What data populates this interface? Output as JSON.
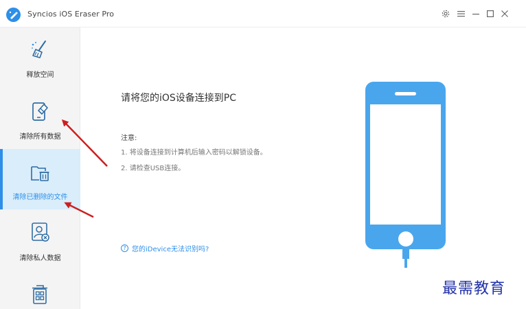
{
  "app": {
    "title": "Syncios iOS Eraser Pro",
    "icons": [
      "app-logo-icon",
      "settings-icon",
      "menu-icon",
      "minimize-icon",
      "maximize-icon",
      "close-icon"
    ]
  },
  "sidebar": {
    "items": [
      {
        "label": "释放空间",
        "icon": "broom-icon",
        "active": false
      },
      {
        "label": "清除所有数据",
        "icon": "phone-eraser-icon",
        "active": false
      },
      {
        "label": "清除已删除的文件",
        "icon": "folder-trash-icon",
        "active": true
      },
      {
        "label": "清除私人数据",
        "icon": "user-remove-icon",
        "active": false
      },
      {
        "label": "",
        "icon": "app-grid-trash-icon",
        "active": false
      }
    ]
  },
  "main": {
    "headline": "请将您的iOS设备连接到PC",
    "note_title": "注意:",
    "note_lines": [
      "1. 将设备连接到计算机后输入密码以解锁设备。",
      "2. 请检查USB连接。"
    ],
    "help_link": "您的iDevice无法识别吗?",
    "help_icon": "?"
  },
  "watermark": "最需教育",
  "colors": {
    "accent": "#2e8fe8",
    "phone": "#4aa6ec",
    "arrow": "#cc1f1f",
    "active_bg": "#d9edfb",
    "sidebar_bg": "#f4f4f4"
  }
}
